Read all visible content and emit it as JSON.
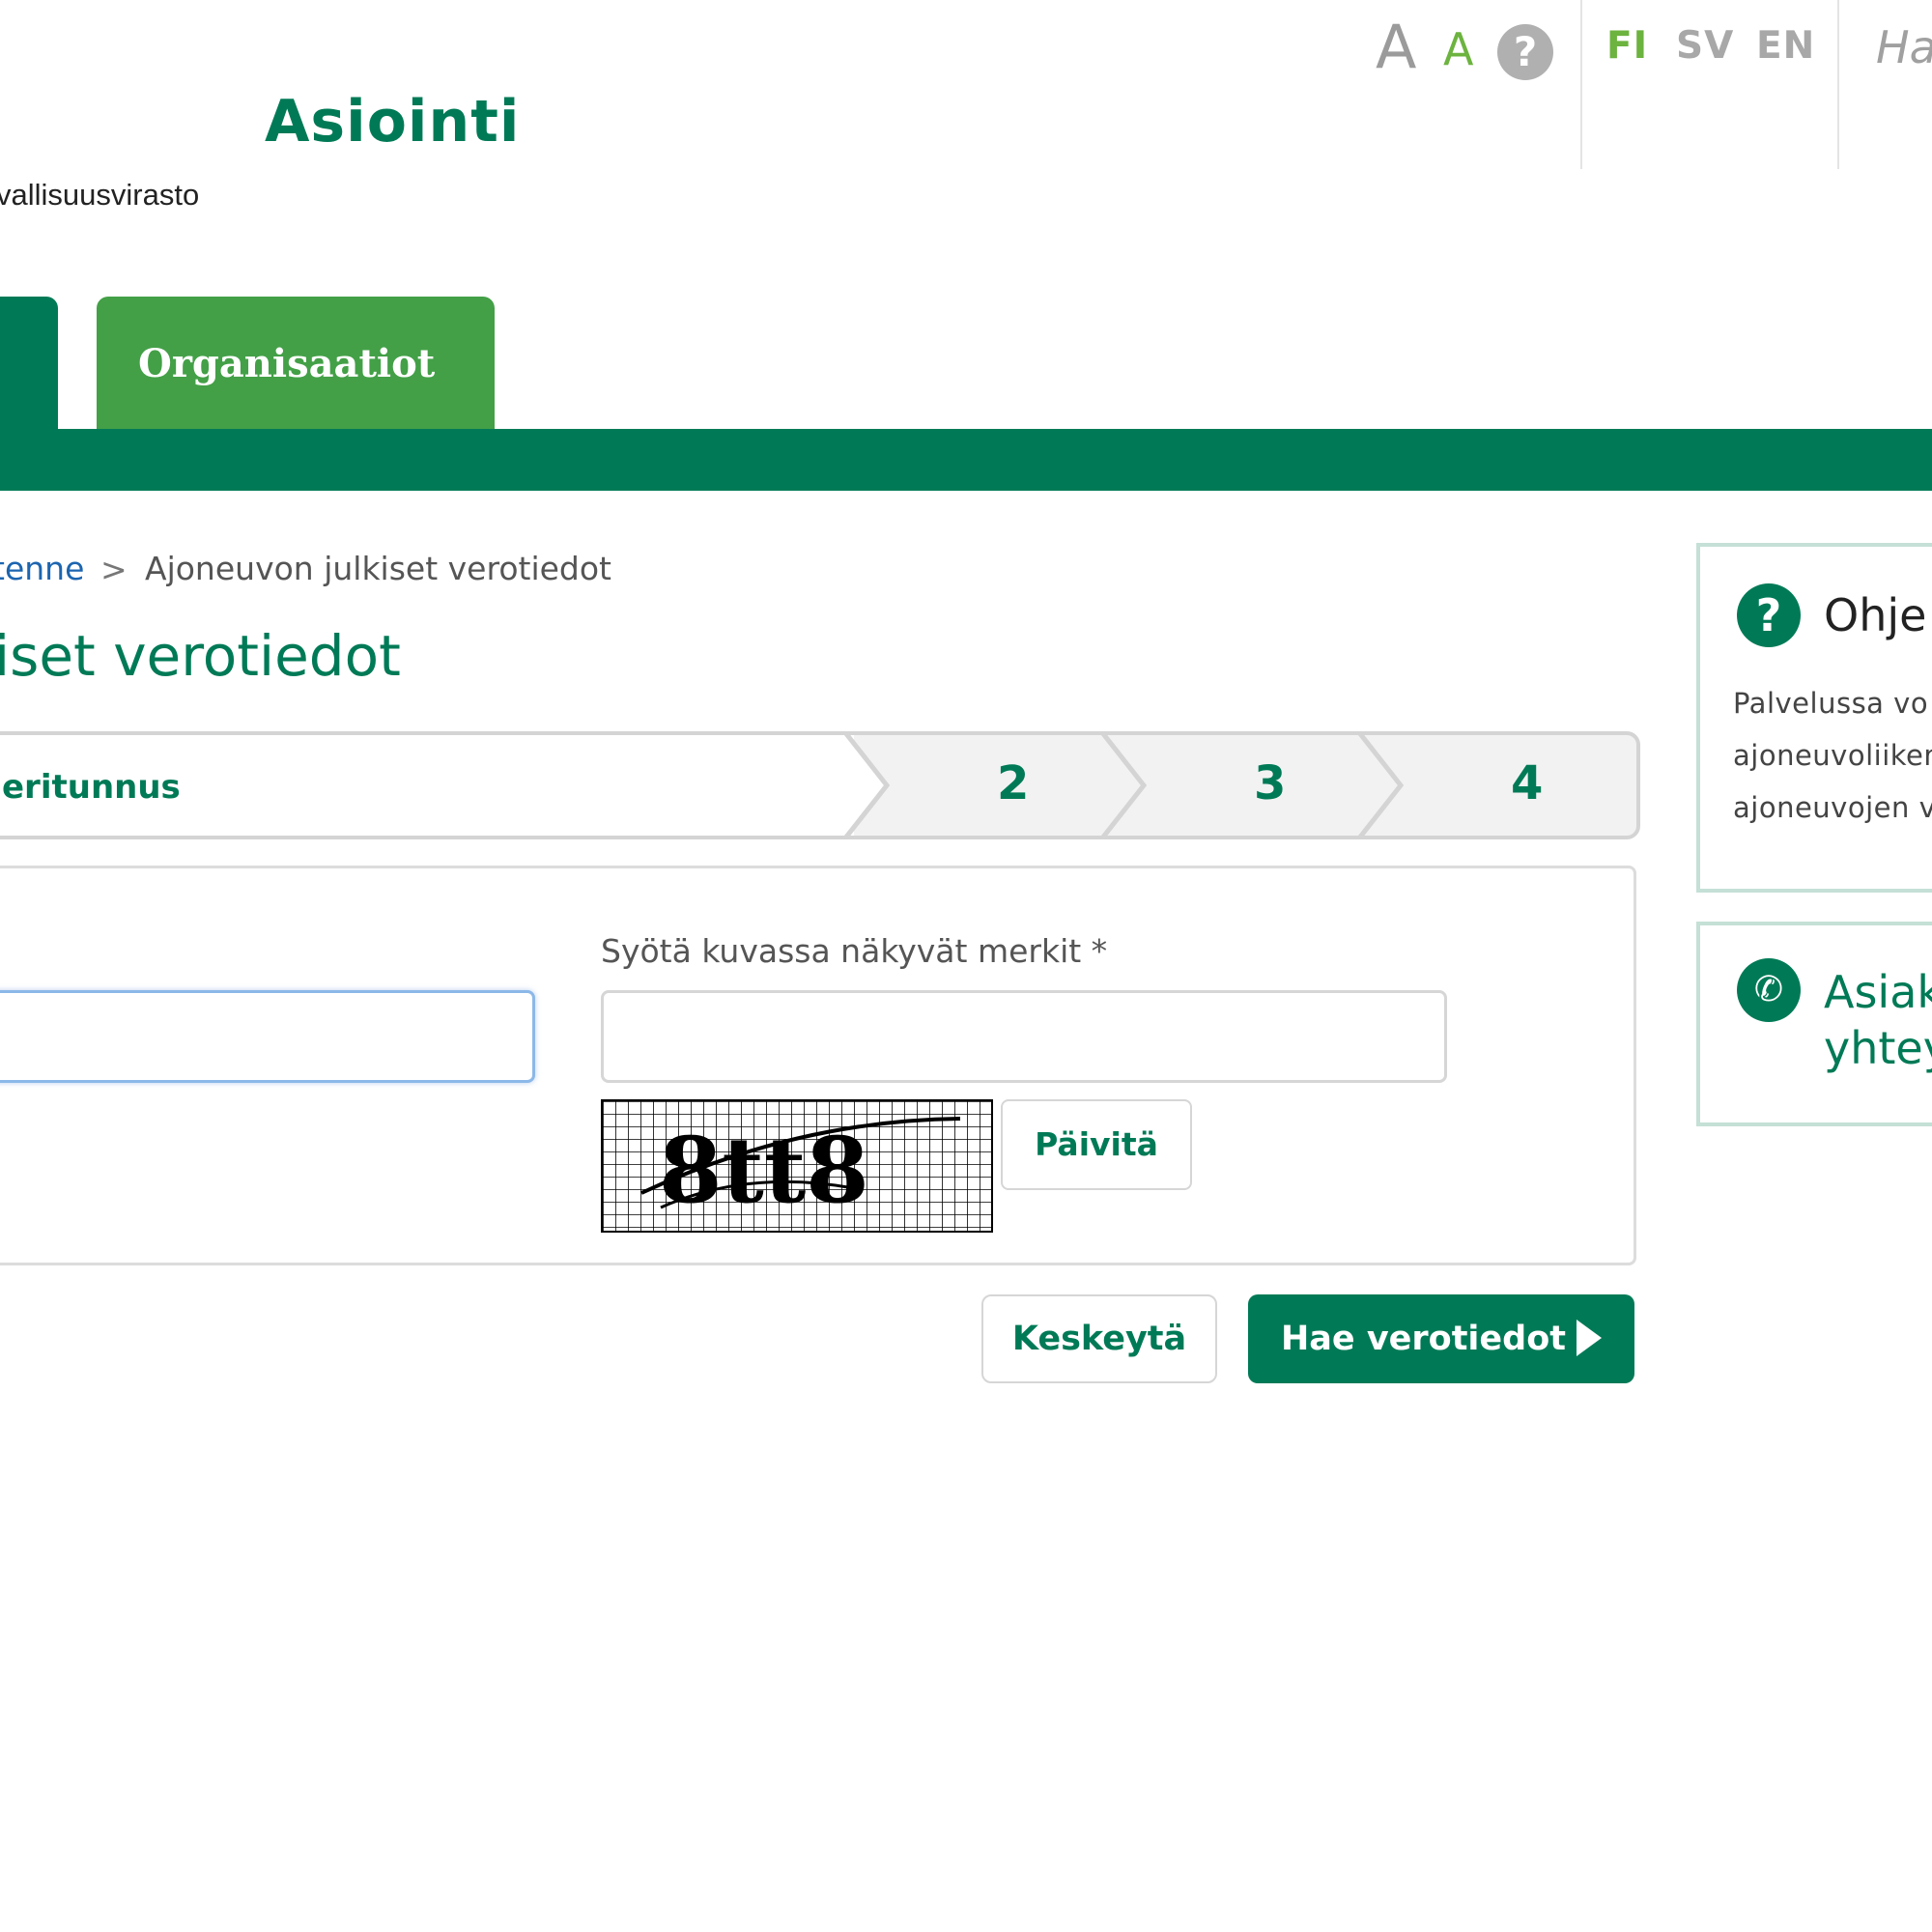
{
  "header": {
    "font_large_glyph": "A",
    "font_small_glyph": "A",
    "help_glyph": "?",
    "languages": [
      "FI",
      "SV",
      "EN"
    ],
    "search_hint": "Ha",
    "brand_title": "Asiointi",
    "brand_subtitle": "vallisuusvirasto"
  },
  "nav": {
    "tabs": [
      {
        "label": ""
      },
      {
        "label": "Organisaatiot"
      }
    ]
  },
  "breadcrumb": {
    "link": "tenne",
    "separator": ">",
    "current": "Ajoneuvon julkiset verotiedot"
  },
  "page_title": "iset verotiedot",
  "stepper": {
    "active_label": "eritunnus",
    "steps": [
      "2",
      "3",
      "4"
    ]
  },
  "form": {
    "captcha_label": "Syötä kuvassa näkyvät merkit *",
    "captcha_text": "8tt8",
    "refresh_label": "Päivitä",
    "left_input_value": "",
    "captcha_input_value": ""
  },
  "actions": {
    "cancel_label": "Keskeytä",
    "submit_label": "Hae verotiedot"
  },
  "sidebar": {
    "help": {
      "title": "Ohje",
      "lines": [
        "Palvelussa vo",
        "ajoneuvoliiken",
        "ajoneuvojen v"
      ]
    },
    "contact": {
      "title_lines": [
        "Asiak",
        "yhtey"
      ]
    }
  },
  "colors": {
    "brand_green": "#007a56",
    "tab_green": "#43a047",
    "accent_light_green": "#6cb33f",
    "link_blue": "#1c65b0"
  }
}
